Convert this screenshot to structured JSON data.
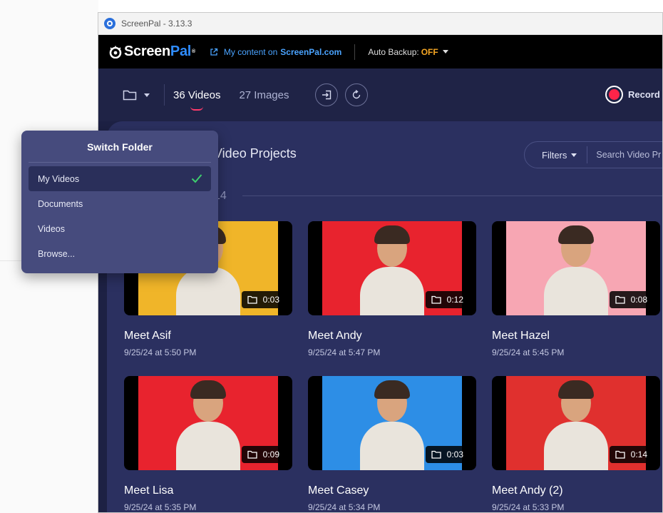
{
  "window": {
    "title": "ScreenPal - 3.13.3"
  },
  "header": {
    "logo": {
      "part1": "Screen",
      "part2": "Pal",
      "mark": "®"
    },
    "my_content": {
      "prefix": "My content on",
      "site": "ScreenPal.com"
    },
    "auto_backup": {
      "label": "Auto Backup:",
      "value": "OFF"
    }
  },
  "toolbar": {
    "tabs": [
      {
        "label": "36 Videos",
        "active": true
      },
      {
        "label": "27 Images",
        "active": false
      }
    ],
    "record_label": "Record"
  },
  "content": {
    "section_title": "Video Projects",
    "filters_label": "Filters",
    "search_placeholder": "Search Video Pr",
    "date_group": "14"
  },
  "videos": [
    {
      "name": "Meet Asif",
      "date": "9/25/24 at 5:50 PM",
      "duration": "0:03",
      "bg": "#f0b529"
    },
    {
      "name": "Meet Andy",
      "date": "9/25/24 at 5:47 PM",
      "duration": "0:12",
      "bg": "#e8232e"
    },
    {
      "name": "Meet Hazel",
      "date": "9/25/24 at 5:45 PM",
      "duration": "0:08",
      "bg": "#f7a6b3"
    },
    {
      "name": "Meet Lisa",
      "date": "9/25/24 at 5:35 PM",
      "duration": "0:09",
      "bg": "#e8232e"
    },
    {
      "name": "Meet Casey",
      "date": "9/25/24 at 5:34 PM",
      "duration": "0:03",
      "bg": "#2d8ee6"
    },
    {
      "name": "Meet Andy (2)",
      "date": "9/25/24 at 5:33 PM",
      "duration": "0:14",
      "bg": "#e0302e"
    }
  ],
  "switch_folder": {
    "title": "Switch Folder",
    "items": [
      {
        "label": "My Videos",
        "selected": true
      },
      {
        "label": "Documents",
        "selected": false
      },
      {
        "label": "Videos",
        "selected": false
      },
      {
        "label": "Browse...",
        "selected": false
      }
    ]
  },
  "colors": {
    "accent": "#2f8cff",
    "record": "#ff2449",
    "backup_off": "#f5a623",
    "check": "#3ecf6e"
  }
}
